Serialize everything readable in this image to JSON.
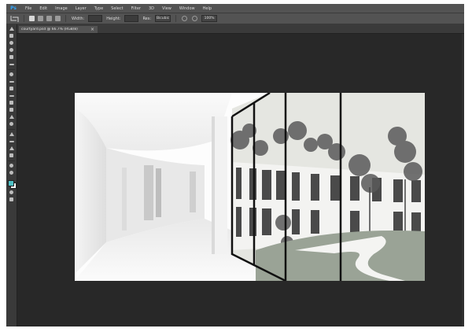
{
  "app": {
    "logo_text": "Ps"
  },
  "menu": {
    "items": [
      "File",
      "Edit",
      "Image",
      "Layer",
      "Type",
      "Select",
      "Filter",
      "3D",
      "View",
      "Window",
      "Help"
    ]
  },
  "options": {
    "labels": [
      "Width:",
      "Height:",
      "Res:"
    ],
    "resample_value": "Bicubic",
    "zoom_value": "100%"
  },
  "document": {
    "tab_title": "courtyard.psd @ 66.7% (RGB/8)",
    "close_glyph": "×"
  },
  "toolbar": {
    "foreground_color": "#4fc1c6",
    "background_color": "#ffffff"
  },
  "canvas": {
    "workspace_color": "#282828",
    "sky_color": "#e5e6e1"
  }
}
